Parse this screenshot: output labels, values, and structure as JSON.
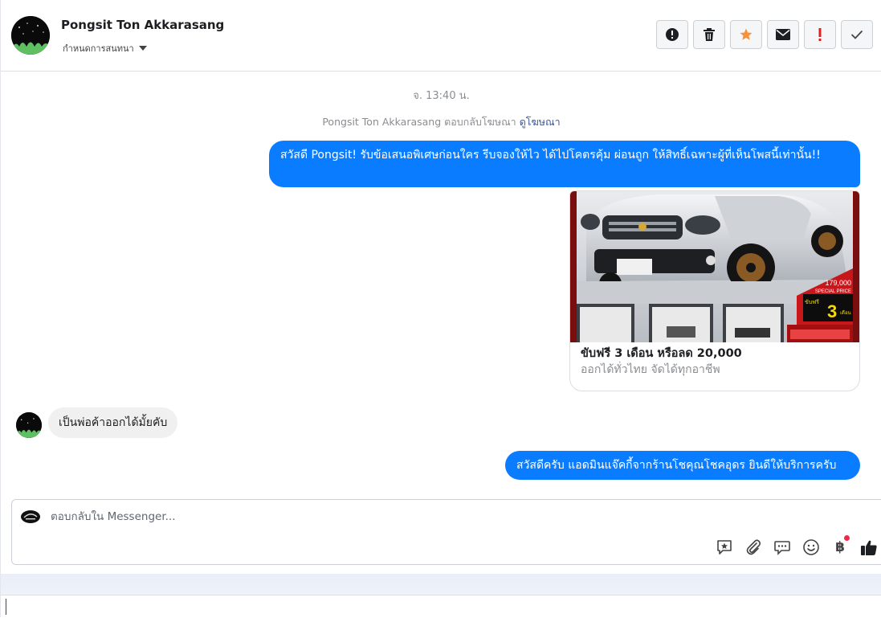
{
  "header": {
    "contact_name": "Pongsit Ton Akkarasang",
    "assign_label": "กำหนดการสนทนา",
    "actions": [
      {
        "name": "report-spam-button",
        "icon": "alert-circle-icon"
      },
      {
        "name": "delete-button",
        "icon": "trash-icon"
      },
      {
        "name": "star-button",
        "icon": "star-icon"
      },
      {
        "name": "mark-unread-button",
        "icon": "envelope-icon"
      },
      {
        "name": "mark-important-button",
        "icon": "exclamation-icon"
      },
      {
        "name": "mark-done-button",
        "icon": "check-icon"
      }
    ]
  },
  "conversation": {
    "time_divider": "จ. 13:40 น.",
    "reply_note_prefix": "Pongsit Ton Akkarasang ตอบกลับโฆษณา",
    "reply_note_link": "ดูโฆษณา",
    "messages": [
      {
        "direction": "outgoing",
        "text": "สวัสดี Pongsit! รับข้อเสนอพิเศษก่อนใคร รีบจองให้ไว ได้ไปโคตรคุ้ม ผ่อนถูก ให้สิทธิ์เฉพาะผู้ที่เห็นโพสนี้เท่านั้น!!"
      },
      {
        "direction": "incoming",
        "text": "เป็นพ่อค้าออกได้มั้ยคับ"
      },
      {
        "direction": "outgoing",
        "text": "สวัสดีครับ แอดมินแจ๊คกี้จากร้านโชคุณโชคอุดร ยินดีให้บริการครับ"
      }
    ],
    "ad_card": {
      "title": "ขับฟรี 3 เดือน หรือลด 20,000",
      "subtitle": "ออกได้ทั่วไทย จัดได้ทุกอาชีพ",
      "image_price": "179,000",
      "image_special": "SPECIAL PRICE",
      "image_free": "ขับฟรี",
      "image_months_num": "3",
      "image_months": "เดือน"
    }
  },
  "composer": {
    "placeholder": "ตอบกลับใน Messenger...",
    "tools": [
      "saved-reply-icon",
      "paperclip-icon",
      "chat-bubbles-icon",
      "smiley-icon",
      "baht-icon",
      "thumbs-up-icon"
    ],
    "baht_symbol": "฿"
  },
  "colors": {
    "outgoing_bubble": "#0a7cff",
    "incoming_bubble": "#f0f0f0",
    "star": "#f7923b",
    "important": "#e02020",
    "link": "#385898"
  }
}
